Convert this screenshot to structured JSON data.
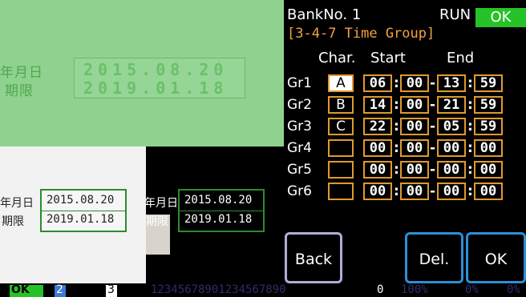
{
  "preview_top": {
    "label_date": "年月日",
    "label_expiry": "期限",
    "date_value": "2015.08.20",
    "expiry_value": "2019.01.18"
  },
  "preview_bottom_left": {
    "label_date": "年月日",
    "label_expiry": "期限",
    "date_value": "2015.08.20",
    "expiry_value": "2019.01.18"
  },
  "preview_bottom_right": {
    "label_date": "年月日",
    "label_expiry": "期限",
    "date_value": "2015.08.20",
    "expiry_value": "2019.01.18"
  },
  "panel": {
    "bank_no": "BankNo. 1",
    "run_label": "RUN",
    "ok_badge": "OK",
    "title": "[3-4-7 Time Group]",
    "col_char": "Char.",
    "col_start": "Start",
    "col_end": "End",
    "groups": [
      {
        "label": "Gr1",
        "char": "A",
        "sh": "06",
        "sm": "00",
        "eh": "13",
        "em": "59"
      },
      {
        "label": "Gr2",
        "char": "B",
        "sh": "14",
        "sm": "00",
        "eh": "21",
        "em": "59"
      },
      {
        "label": "Gr3",
        "char": "C",
        "sh": "22",
        "sm": "00",
        "eh": "05",
        "em": "59"
      },
      {
        "label": "Gr4",
        "char": "",
        "sh": "00",
        "sm": "00",
        "eh": "00",
        "em": "00"
      },
      {
        "label": "Gr5",
        "char": "",
        "sh": "00",
        "sm": "00",
        "eh": "00",
        "em": "00"
      },
      {
        "label": "Gr6",
        "char": "",
        "sh": "00",
        "sm": "00",
        "eh": "00",
        "em": "00"
      }
    ],
    "btn_back": "Back",
    "btn_del": "Del.",
    "btn_ok": "OK"
  },
  "statusbar": {
    "ok": "OK",
    "ch2": "2",
    "ch3": "3",
    "digits": "12345678901234567890",
    "count": "0",
    "pct1": "100%",
    "pct2": "0%",
    "pct3": "0%"
  },
  "colors": {
    "accent_orange": "#f4a23c",
    "ok_green": "#27c227",
    "preview_green": "#8fd28f",
    "button_blue": "#2d8fd6",
    "button_lavender": "#b7a9d8"
  }
}
